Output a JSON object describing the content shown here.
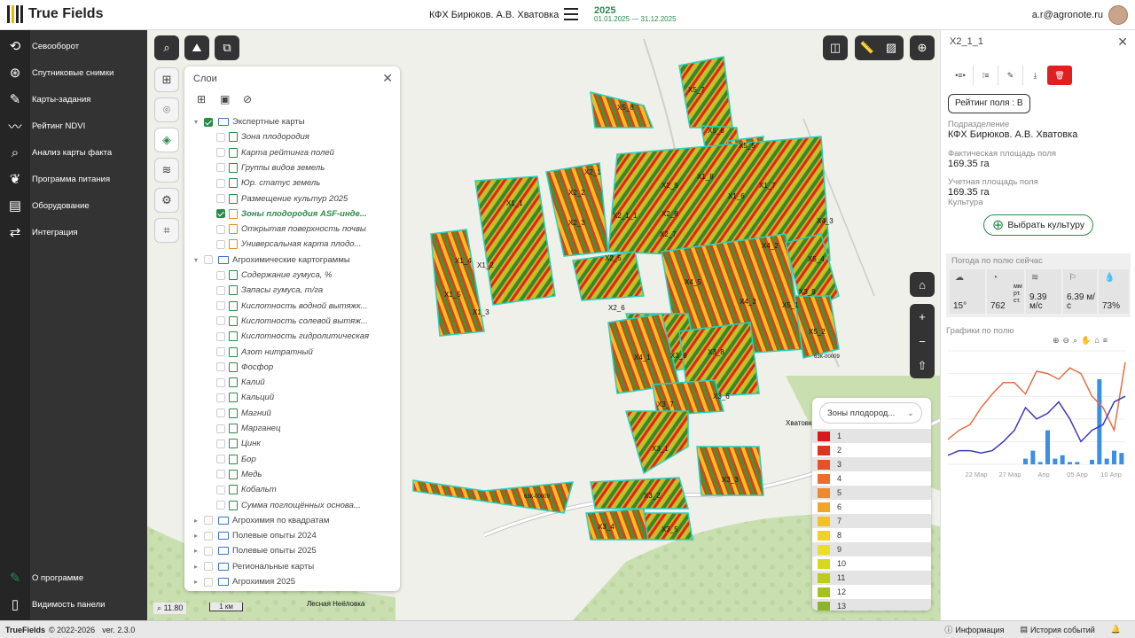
{
  "header": {
    "app_name": "True Fields",
    "farm": "КФХ Бирюков. А.В.  Хватовка",
    "season_year": "2025",
    "season_dates": "01.01.2025 — 31.12.2025",
    "user_email": "a.r@agronote.ru"
  },
  "sidebar": {
    "items": [
      {
        "label": "Севооборот",
        "icon": "crop-rotation-icon"
      },
      {
        "label": "Спутниковые снимки",
        "icon": "satellite-icon"
      },
      {
        "label": "Карты-задания",
        "icon": "task-map-icon"
      },
      {
        "label": "Рейтинг NDVI",
        "icon": "ndvi-chart-icon"
      },
      {
        "label": "Анализ карты факта",
        "icon": "analysis-icon"
      },
      {
        "label": "Программа питания",
        "icon": "nutrition-icon"
      },
      {
        "label": "Оборудование",
        "icon": "equipment-icon"
      },
      {
        "label": "Интеграция",
        "icon": "integration-icon"
      }
    ],
    "about": "О программе",
    "panel_visibility": "Видимость панели"
  },
  "layers_panel": {
    "title": "Слои",
    "rows": [
      {
        "label": "Экспертные карты",
        "type": "group",
        "expanded": true,
        "checked": true
      },
      {
        "label": "Зона плодородия",
        "type": "layer",
        "checked": false,
        "color": "green"
      },
      {
        "label": "Карта рейтинга полей",
        "type": "layer",
        "checked": false,
        "color": "green"
      },
      {
        "label": "Группы видов земель",
        "type": "layer",
        "checked": false,
        "color": "green"
      },
      {
        "label": "Юр. статус земель",
        "type": "layer",
        "checked": false,
        "color": "green"
      },
      {
        "label": "Размещение культур 2025",
        "type": "layer",
        "checked": false,
        "color": "green"
      },
      {
        "label": "Зоны плодородия ASF-инде...",
        "type": "layer",
        "checked": true,
        "color": "orange",
        "bold": true
      },
      {
        "label": "Открытая поверхность почвы",
        "type": "layer",
        "checked": false,
        "color": "orange"
      },
      {
        "label": "Универсальная карта плодо...",
        "type": "layer",
        "checked": false,
        "color": "orange"
      },
      {
        "label": "Агрохимические картограммы",
        "type": "group",
        "expanded": true,
        "checked": false
      },
      {
        "label": "Содержание гумуса, %",
        "type": "layer",
        "checked": false,
        "color": "green"
      },
      {
        "label": "Запасы гумуса, т/га",
        "type": "layer",
        "checked": false,
        "color": "green"
      },
      {
        "label": "Кислотность водной вытяжк...",
        "type": "layer",
        "checked": false,
        "color": "green"
      },
      {
        "label": "Кислотность солевой вытяж...",
        "type": "layer",
        "checked": false,
        "color": "green"
      },
      {
        "label": "Кислотность гидролитическая",
        "type": "layer",
        "checked": false,
        "color": "green"
      },
      {
        "label": "Азот нитратный",
        "type": "layer",
        "checked": false,
        "color": "green"
      },
      {
        "label": "Фосфор",
        "type": "layer",
        "checked": false,
        "color": "green"
      },
      {
        "label": "Калий",
        "type": "layer",
        "checked": false,
        "color": "green"
      },
      {
        "label": "Кальций",
        "type": "layer",
        "checked": false,
        "color": "green"
      },
      {
        "label": "Магний",
        "type": "layer",
        "checked": false,
        "color": "green"
      },
      {
        "label": "Марганец",
        "type": "layer",
        "checked": false,
        "color": "green"
      },
      {
        "label": "Цинк",
        "type": "layer",
        "checked": false,
        "color": "green"
      },
      {
        "label": "Бор",
        "type": "layer",
        "checked": false,
        "color": "green"
      },
      {
        "label": "Медь",
        "type": "layer",
        "checked": false,
        "color": "green"
      },
      {
        "label": "Кобальт",
        "type": "layer",
        "checked": false,
        "color": "green"
      },
      {
        "label": "Сумма поглощённых основа...",
        "type": "layer",
        "checked": false,
        "color": "green"
      },
      {
        "label": "Агрохимия по квадратам",
        "type": "group",
        "expanded": false,
        "checked": false
      },
      {
        "label": "Полевые опыты 2024",
        "type": "group",
        "expanded": false,
        "checked": false
      },
      {
        "label": "Полевые опыты 2025",
        "type": "group",
        "expanded": false,
        "checked": false
      },
      {
        "label": "Региональные карты",
        "type": "group",
        "expanded": false,
        "checked": false
      },
      {
        "label": "Агрохимия 2025",
        "type": "group",
        "expanded": false,
        "checked": false
      }
    ]
  },
  "legend": {
    "selected": "Зоны плодород...",
    "items": [
      {
        "label": "1",
        "color": "#d7191c"
      },
      {
        "label": "2",
        "color": "#dd3522"
      },
      {
        "label": "3",
        "color": "#e4522a"
      },
      {
        "label": "4",
        "color": "#eb6e30"
      },
      {
        "label": "5",
        "color": "#ef8a2c"
      },
      {
        "label": "6",
        "color": "#f1a529"
      },
      {
        "label": "7",
        "color": "#f3c125"
      },
      {
        "label": "8",
        "color": "#f0d223"
      },
      {
        "label": "9",
        "color": "#e8e020"
      },
      {
        "label": "10",
        "color": "#d4d81e"
      },
      {
        "label": "11",
        "color": "#bccc1f"
      },
      {
        "label": "12",
        "color": "#a4c022"
      },
      {
        "label": "13",
        "color": "#8cb424"
      }
    ]
  },
  "map": {
    "zoom": "11.80",
    "scale_label": "1 км",
    "place_labels": [
      "Хватовка",
      "Лесная Неёловка"
    ],
    "road_labels": [
      "63К-00009",
      "63К-00009"
    ],
    "fields": [
      "X5_7",
      "X5_8",
      "X5_6",
      "X5_5",
      "X2_1",
      "X1_8",
      "X1_7",
      "X2_2",
      "X2_9",
      "X1_6",
      "X1_1",
      "X2_3",
      "X2_1_1",
      "X2_8",
      "X4_3",
      "X2_7",
      "X4_2",
      "X1_4",
      "X1_2",
      "X2_5",
      "X5_4",
      "X1_5",
      "X4_5",
      "X3_9",
      "X1_3",
      "X2_6",
      "X4_3",
      "X5_1",
      "X5_2",
      "X4_1",
      "X3_9",
      "X3_8",
      "X3_7",
      "X3_6",
      "X3_1",
      "X3_3",
      "X3_2",
      "X3_4",
      "X3_5"
    ]
  },
  "field_panel": {
    "title": "X2_1_1",
    "rating": "Рейтинг поля : B",
    "division_label": "Подразделение",
    "division_value": "КФХ Бирюков. А.В. Хватовка",
    "actual_area_label": "Фактическая площадь поля",
    "actual_area_value": "169.35 га",
    "account_area_label": "Учетная площадь поля",
    "account_area_value": "169.35 га",
    "crop_label": "Культура",
    "choose_crop": "Выбрать культуру",
    "weather_title": "Погода по полю сейчас",
    "weather": {
      "temp": "15°",
      "pressure": "762",
      "pressure_unit_1": "мм",
      "pressure_unit_2": "рт.",
      "pressure_unit_3": "ст.",
      "wind": "9.39",
      "wind_unit": "м/с",
      "gust": "6.39 м/",
      "gust_unit": "с",
      "humidity": "73%"
    },
    "charts_title": "Графики по полю",
    "chart_axis": [
      "22 Мар",
      "27 Мар",
      "Апр",
      "05 Апр",
      "10 Апр"
    ]
  },
  "chart_data": {
    "type": "line",
    "x": [
      "22 Мар",
      "27 Мар",
      "Апр",
      "05 Апр",
      "10 Апр"
    ],
    "series": [
      {
        "color": "#e0704a",
        "values": [
          0.22,
          0.3,
          0.35,
          0.5,
          0.62,
          0.72,
          0.72,
          0.62,
          0.82,
          0.8,
          0.75,
          0.85,
          0.8,
          0.6,
          0.5,
          0.3,
          0.9
        ]
      },
      {
        "color": "#3b3bb8",
        "values": [
          0.08,
          0.12,
          0.12,
          0.1,
          0.12,
          0.2,
          0.3,
          0.5,
          0.4,
          0.45,
          0.55,
          0.4,
          0.2,
          0.3,
          0.35,
          0.55,
          0.6
        ]
      }
    ],
    "bars": [
      0,
      0,
      0,
      0,
      0,
      0,
      0,
      0,
      0,
      0,
      0.05,
      0.12,
      0.02,
      0.3,
      0.05,
      0.08,
      0.02,
      0.02,
      0.0,
      0.04,
      0.75,
      0.05,
      0.12,
      0.1
    ]
  },
  "footer": {
    "brand": "TrueFields",
    "copyright": "© 2022-2026",
    "version": "ver. 2.3.0",
    "info": "Информация",
    "history": "История событий"
  }
}
